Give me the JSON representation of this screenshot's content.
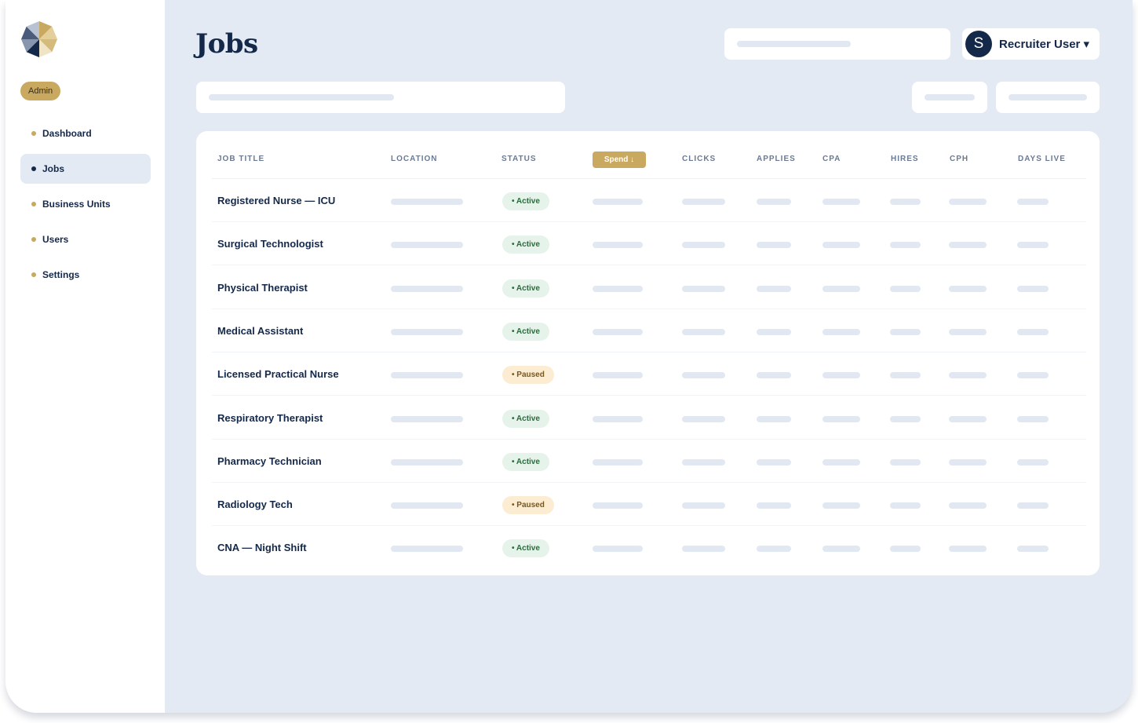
{
  "sidebar": {
    "role_badge": "Admin",
    "items": [
      {
        "label": "Dashboard",
        "active": false
      },
      {
        "label": "Jobs",
        "active": true
      },
      {
        "label": "Business Units",
        "active": false
      },
      {
        "label": "Users",
        "active": false
      },
      {
        "label": "Settings",
        "active": false
      }
    ]
  },
  "header": {
    "title": "Jobs",
    "user": {
      "initial": "S",
      "name": "Recruiter User ▾"
    }
  },
  "table": {
    "columns": [
      "JOB TITLE",
      "LOCATION",
      "STATUS",
      "Spend ↓",
      "CLICKS",
      "APPLIES",
      "CPA",
      "HIRES",
      "CPH",
      "DAYS LIVE"
    ],
    "sorted_column": "Spend ↓",
    "rows": [
      {
        "title": "Registered Nurse — ICU",
        "status": "• Active",
        "status_kind": "active"
      },
      {
        "title": "Surgical Technologist",
        "status": "• Active",
        "status_kind": "active"
      },
      {
        "title": "Physical Therapist",
        "status": "• Active",
        "status_kind": "active"
      },
      {
        "title": "Medical Assistant",
        "status": "• Active",
        "status_kind": "active"
      },
      {
        "title": "Licensed Practical Nurse",
        "status": "• Paused",
        "status_kind": "paused"
      },
      {
        "title": "Respiratory Therapist",
        "status": "• Active",
        "status_kind": "active"
      },
      {
        "title": "Pharmacy Technician",
        "status": "• Active",
        "status_kind": "active"
      },
      {
        "title": "Radiology Tech",
        "status": "• Paused",
        "status_kind": "paused"
      },
      {
        "title": "CNA — Night Shift",
        "status": "• Active",
        "status_kind": "active"
      }
    ]
  },
  "colors": {
    "navy": "#14284a",
    "gold": "#c9a860",
    "background": "#e3eaf4",
    "active_bg": "#e6f3ea",
    "paused_bg": "#fbecd2"
  }
}
